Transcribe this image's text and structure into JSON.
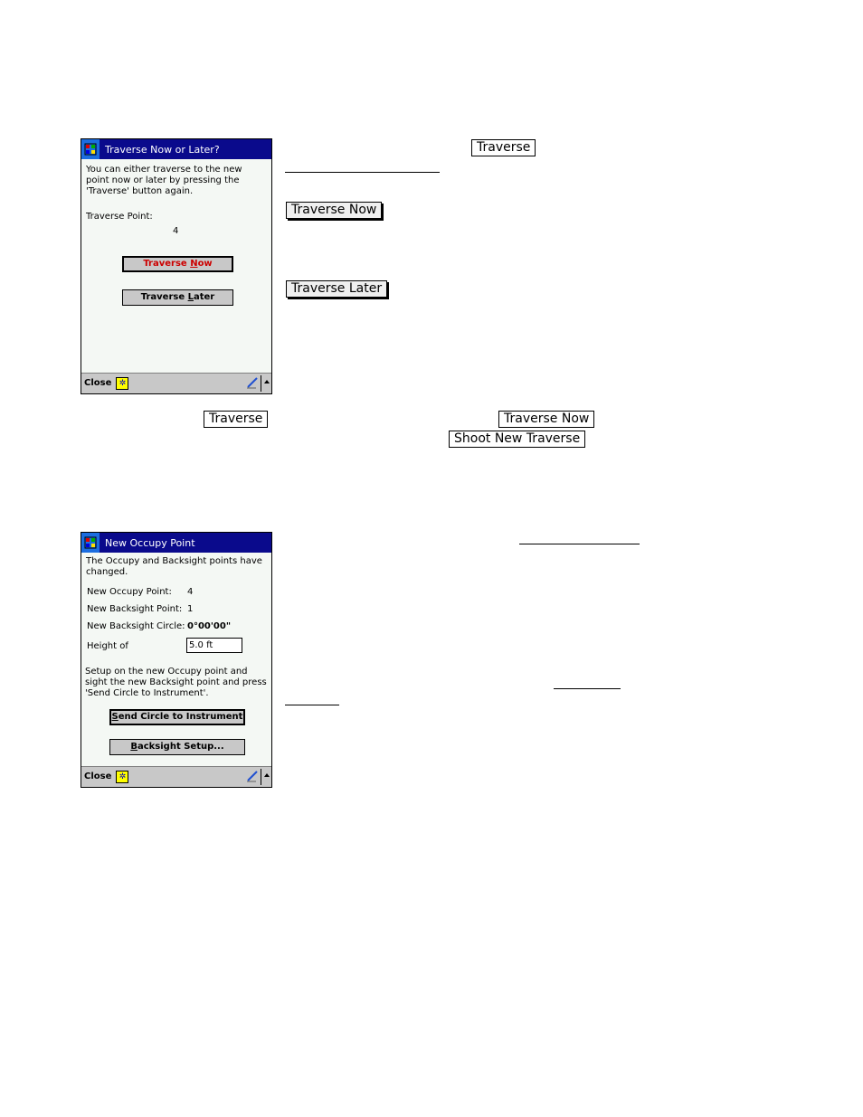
{
  "screen1": {
    "title": "Traverse Now or Later?",
    "message": "You can either traverse to the new point now or later by pressing the 'Traverse' button again.",
    "point_label": "Traverse Point:",
    "point_value": "4",
    "btn_now_pre": "Traverse ",
    "btn_now_ul": "N",
    "btn_now_post": "ow",
    "btn_later_pre": "Traverse ",
    "btn_later_ul": "L",
    "btn_later_post": "ater",
    "close": "Close",
    "sip_glyph": "✲",
    "accent_color": "#cc0000"
  },
  "screen2": {
    "title": "New Occupy Point",
    "message": "The Occupy and Backsight points have changed.",
    "rows": [
      {
        "label": "New Occupy Point:",
        "value": "4"
      },
      {
        "label": "New Backsight Point:",
        "value": "1"
      },
      {
        "label": "New Backsight Circle:",
        "value": "0°00'00\""
      }
    ],
    "height_label": "Height of",
    "height_value": "5.0 ft",
    "instructions": "Setup on the new Occupy point and sight the new Backsight point and press 'Send Circle to Instrument'.",
    "btn_send_ul": "S",
    "btn_send_post": "end Circle to Instrument",
    "btn_backsight_ul": "B",
    "btn_backsight_post": "acksight Setup...",
    "close": "Close",
    "sip_glyph": "✲"
  },
  "doc": {
    "btn_traverse_1": "Traverse",
    "btn_traverse_now_1": "Traverse Now",
    "btn_traverse_later": "Traverse Later",
    "btn_traverse_2": "Traverse",
    "btn_traverse_now_2": "Traverse Now",
    "btn_shoot_new": "Shoot New Traverse"
  },
  "colors": {
    "titlebar": "#0a0a8c",
    "start_button": "#1b6de0",
    "command_bar": "#c8c8c8",
    "button_face": "#c8c8c8"
  }
}
